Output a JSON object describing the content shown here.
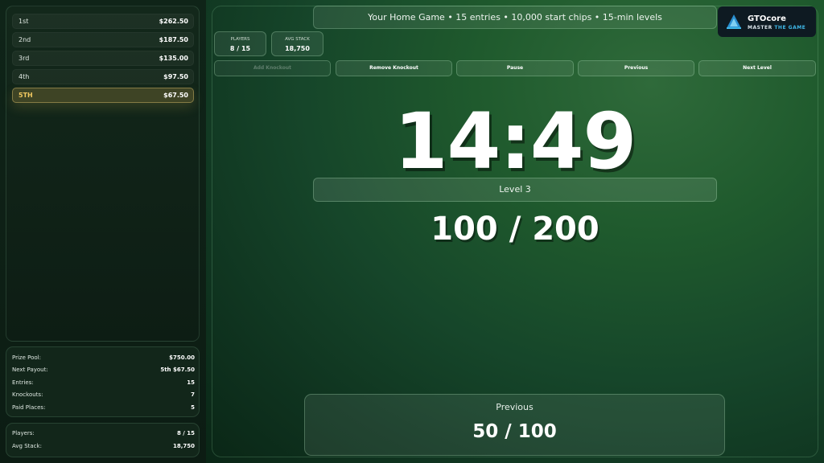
{
  "payouts": [
    {
      "place": "1st",
      "amount": "$262.50"
    },
    {
      "place": "2nd",
      "amount": "$187.50"
    },
    {
      "place": "3rd",
      "amount": "$135.00"
    },
    {
      "place": "4th",
      "amount": "$97.50"
    },
    {
      "place": "5TH",
      "amount": "$67.50"
    }
  ],
  "stats": {
    "prize_pool_label": "Prize Pool:",
    "prize_pool": "$750.00",
    "next_payout_label": "Next Payout:",
    "next_payout": "5th $67.50",
    "entries_label": "Entries:",
    "entries": "15",
    "knockouts_label": "Knockouts:",
    "knockouts": "7",
    "paid_places_label": "Paid Places:",
    "paid_places": "5",
    "players_label": "Players:",
    "players": "8 / 15",
    "avg_stack_label": "Avg Stack:",
    "avg_stack": "18,750"
  },
  "header": {
    "title": "Your Home Game • 15 entries • 10,000 start chips • 15-min levels"
  },
  "logo": {
    "name": "GTOcore",
    "tagline_a": "MASTER ",
    "tagline_b": "THE GAME"
  },
  "cards": {
    "players_label": "PLAYERS",
    "players": "8 / 15",
    "avg_label": "AVG STACK",
    "avg": "18,750"
  },
  "controls": {
    "add_knockout": "Add Knockout",
    "remove_knockout": "Remove Knockout",
    "pause": "Pause",
    "previous": "Previous",
    "next_level": "Next Level"
  },
  "clock": {
    "time": "14:49",
    "level": "Level 3",
    "blinds": "100 / 200"
  },
  "previous_level": {
    "label": "Previous",
    "blinds": "50 / 100"
  },
  "colors": {
    "accent_gold": "#f0c860",
    "logo_blue": "#3fb8e8"
  }
}
